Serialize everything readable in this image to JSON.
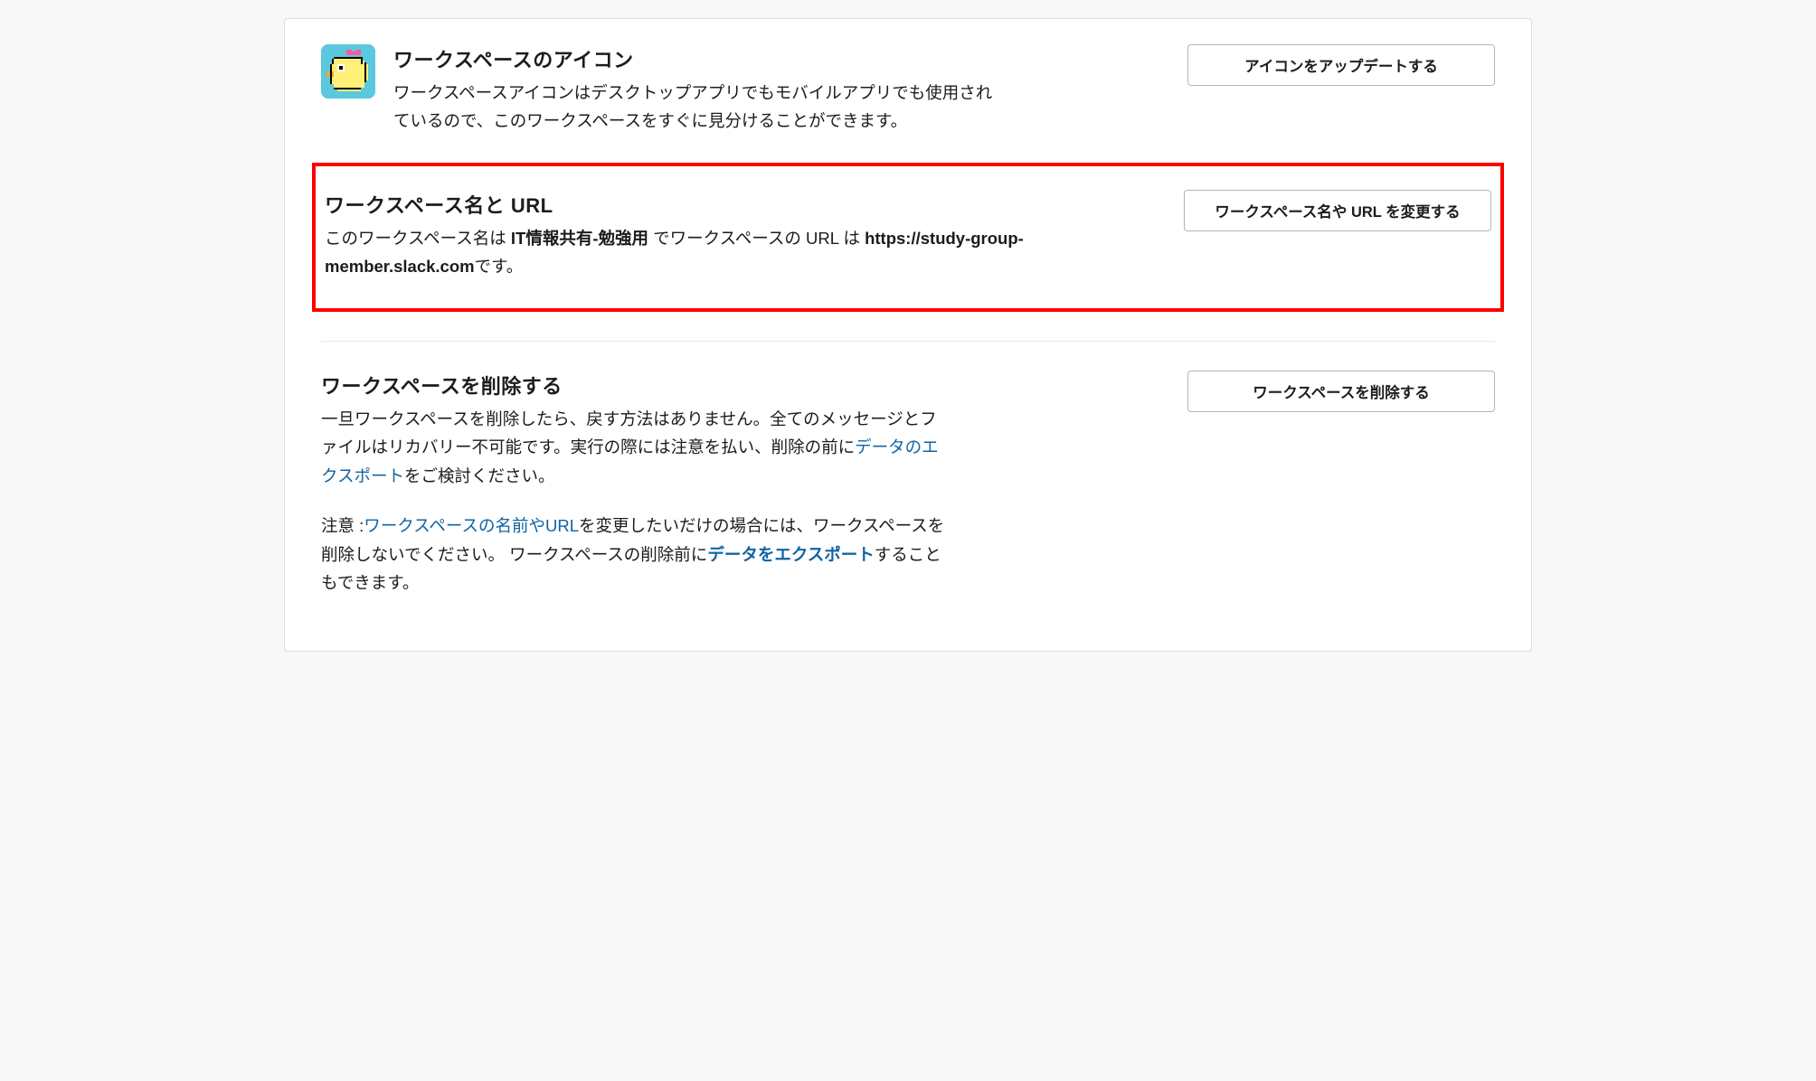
{
  "icon_section": {
    "title": "ワークスペースのアイコン",
    "description": "ワークスペースアイコンはデスクトップアプリでもモバイルアプリでも使用されているので、このワークスペースをすぐに見分けることができます。",
    "button": "アイコンをアップデートする"
  },
  "name_url_section": {
    "title": "ワークスペース名と URL",
    "desc_prefix": "このワークスペース名は ",
    "workspace_name": "IT情報共有-勉強用",
    "desc_mid": " でワークスペースの URL は ",
    "workspace_url": "https://study-group-member.slack.com",
    "desc_suffix": "です。",
    "button": "ワークスペース名や URL を変更する"
  },
  "delete_section": {
    "title": "ワークスペースを削除する",
    "desc_part1": "一旦ワークスペースを削除したら、戻す方法はありません。全てのメッセージとファイルはリカバリー不可能です。実行の際には注意を払い、削除の前に",
    "export_link": "データのエクスポート",
    "desc_part2": "をご検討ください。",
    "note_prefix": "注意 :",
    "note_link1": "ワークスペースの名前やURL",
    "note_mid": "を変更したいだけの場合には、ワークスペースを削除しないでください。 ワークスペースの削除前に",
    "note_link2": "データをエクスポート",
    "note_suffix": "することもできます。",
    "button": "ワークスペースを削除する"
  }
}
